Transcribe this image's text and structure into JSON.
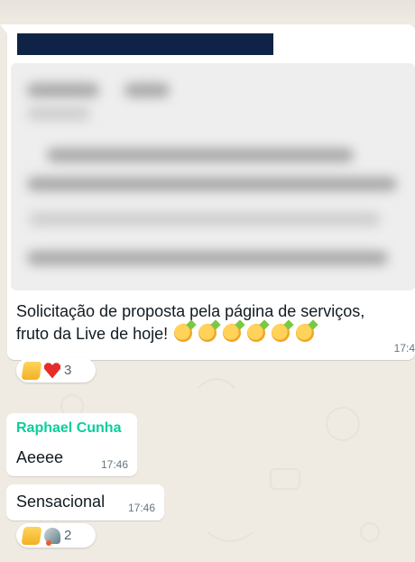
{
  "messages": {
    "first": {
      "text_line_1": "Solicitação de proposta pela página de serviços,",
      "text_line_2": "fruto da Live de hoje!",
      "time": "17:4",
      "reaction_count": "3"
    },
    "second": {
      "sender": "Raphael Cunha",
      "text": "Aeeee",
      "time": "17:46"
    },
    "third": {
      "text": "Sensacional",
      "time": "17:46",
      "reaction_count": "2"
    }
  },
  "icons": {
    "party": "party-face-icon",
    "thumbs": "thumbs-up-icon",
    "heart": "heart-icon",
    "rocket": "rocket-icon"
  },
  "colors": {
    "background": "#efeae2",
    "sender_name": "#06cf9c",
    "redaction": "#0f2346"
  }
}
